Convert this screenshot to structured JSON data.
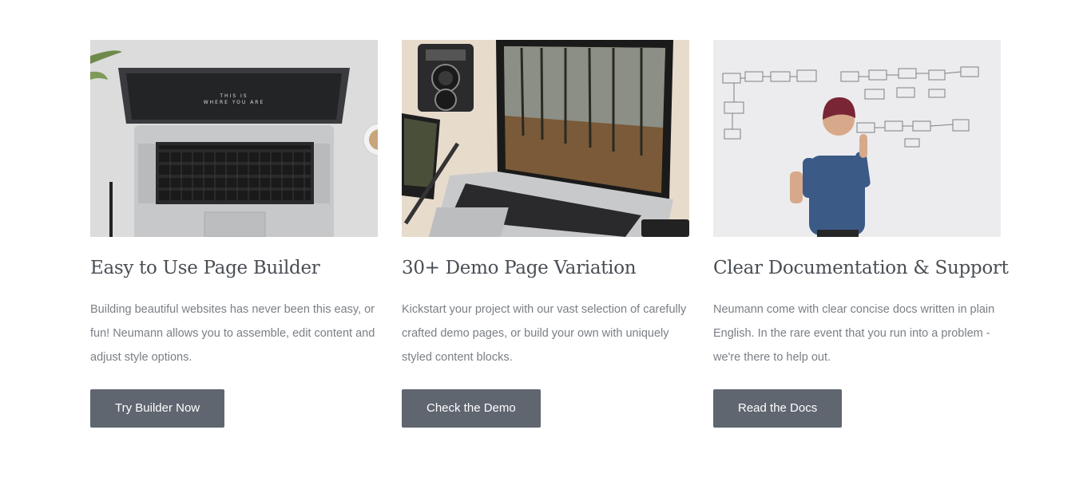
{
  "features": [
    {
      "image": "laptop-top-view-photo",
      "title": "Easy to Use Page Builder",
      "description": "Building beautiful websites has never been this easy, or fun! Neumann allows you to assemble, edit content and adjust style options.",
      "button_label": "Try Builder Now",
      "screen_text_line1": "THIS IS",
      "screen_text_line2": "WHERE YOU ARE"
    },
    {
      "image": "laptop-forest-camera-photo",
      "title": "30+ Demo Page Variation",
      "description": "Kickstart your project with our vast selection of carefully crafted demo pages, or build your own with uniquely styled content blocks.",
      "button_label": "Check the Demo"
    },
    {
      "image": "man-at-whiteboard-photo",
      "title": "Clear Documentation & Support",
      "description": "Neumann come with clear concise docs written in plain English. In the rare event that you run into a problem - we're there to help out.",
      "button_label": "Read the Docs"
    }
  ],
  "colors": {
    "button_bg": "#5f6670",
    "button_text": "#ffffff",
    "title": "#4a4f55",
    "body_text": "#7a7f85"
  }
}
